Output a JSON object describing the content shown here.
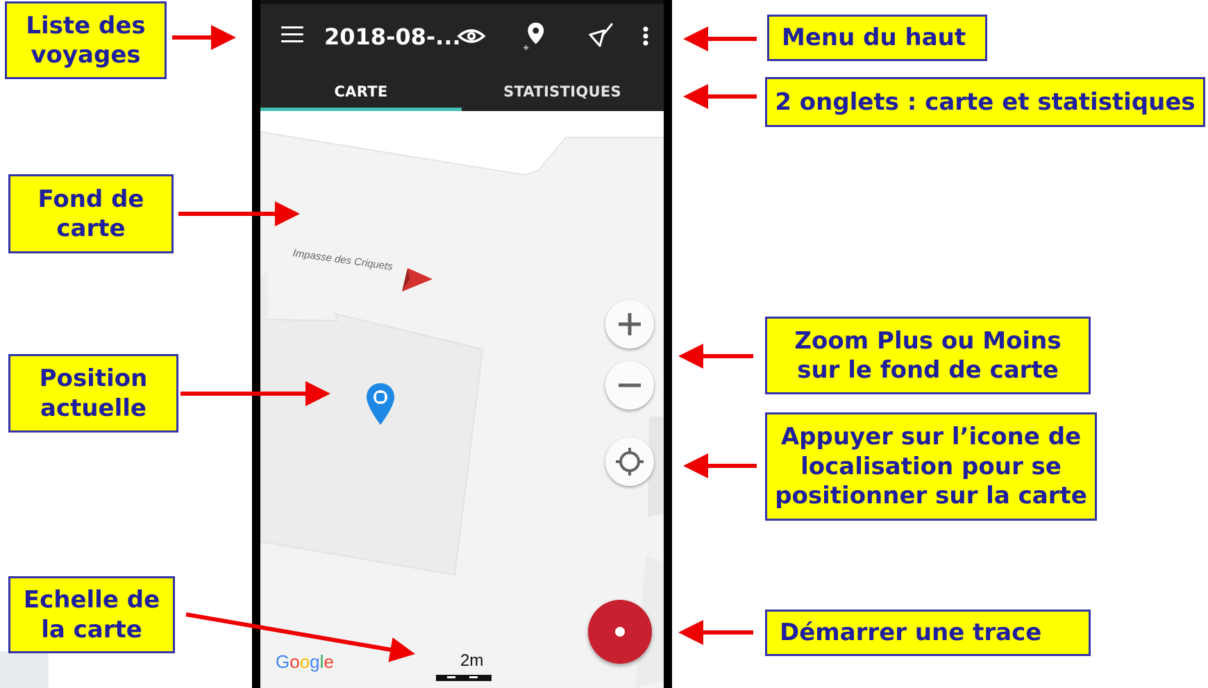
{
  "app": {
    "trip_title": "2018-08-...",
    "tabs": [
      {
        "label": "CARTE",
        "active": true
      },
      {
        "label": "STATISTIQUES",
        "active": false
      }
    ],
    "map": {
      "street_name": "Impasse des Criquets",
      "google_logo": "Google",
      "scale_label": "2m"
    },
    "toolbar_icons": [
      "menu-icon",
      "eye-icon",
      "add-location-icon",
      "broom-icon",
      "more-vert-icon"
    ],
    "colors": {
      "appbar": "#242424",
      "tab_indicator": "#45c1b4",
      "record_button": "#c8202e",
      "location_pin": "#2196f3"
    }
  },
  "callouts": {
    "liste_voyages": "Liste des\nvoyages",
    "menu_haut": "Menu du haut",
    "onglets": "2 onglets : carte et statistiques",
    "fond_carte": "Fond de\ncarte",
    "zoom": "Zoom Plus ou Moins\nsur le fond de carte",
    "position": "Position\nactuelle",
    "localisation": "Appuyer sur l’icone de\nlocalisation pour se\npositionner sur la carte",
    "echelle": "Echelle de\nla carte",
    "demarrer": "Démarrer une trace"
  },
  "callout_colors": {
    "fill": "#ffff00",
    "border": "#3333aa",
    "text": "#1f1f9f",
    "arrow": "#ee0000"
  }
}
